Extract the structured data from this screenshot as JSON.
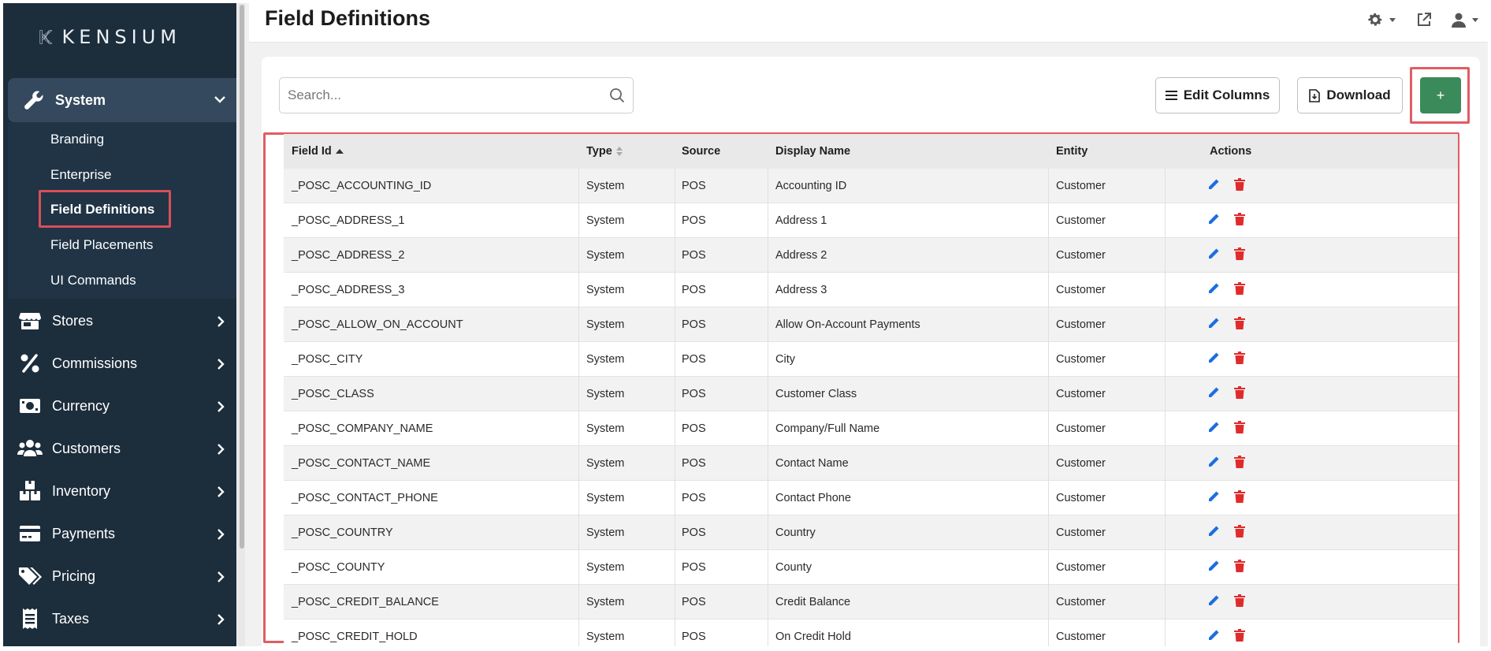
{
  "brand": {
    "name": "KENSIUM"
  },
  "sidebar": {
    "system": {
      "label": "System",
      "icon": "wrench-icon"
    },
    "sub_items": [
      {
        "label": "Branding"
      },
      {
        "label": "Enterprise"
      },
      {
        "label": "Field Definitions",
        "active": true
      },
      {
        "label": "Field Placements"
      },
      {
        "label": "UI Commands"
      }
    ],
    "items": [
      {
        "label": "Stores",
        "icon": "store-icon"
      },
      {
        "label": "Commissions",
        "icon": "percent-icon"
      },
      {
        "label": "Currency",
        "icon": "money-icon"
      },
      {
        "label": "Customers",
        "icon": "users-icon"
      },
      {
        "label": "Inventory",
        "icon": "boxes-icon"
      },
      {
        "label": "Payments",
        "icon": "credit-card-icon"
      },
      {
        "label": "Pricing",
        "icon": "tags-icon"
      },
      {
        "label": "Taxes",
        "icon": "receipt-icon"
      }
    ]
  },
  "header": {
    "title": "Field Definitions"
  },
  "toolbar": {
    "search_placeholder": "Search...",
    "edit_columns_label": "Edit Columns",
    "download_label": "Download",
    "add_label": "+"
  },
  "table": {
    "columns": [
      "Field Id",
      "Type",
      "Source",
      "Display Name",
      "Entity",
      "Actions"
    ],
    "rows": [
      {
        "field_id": "_POSC_ACCOUNTING_ID",
        "type": "System",
        "source": "POS",
        "display_name": "Accounting ID",
        "entity": "Customer"
      },
      {
        "field_id": "_POSC_ADDRESS_1",
        "type": "System",
        "source": "POS",
        "display_name": "Address 1",
        "entity": "Customer"
      },
      {
        "field_id": "_POSC_ADDRESS_2",
        "type": "System",
        "source": "POS",
        "display_name": "Address 2",
        "entity": "Customer"
      },
      {
        "field_id": "_POSC_ADDRESS_3",
        "type": "System",
        "source": "POS",
        "display_name": "Address 3",
        "entity": "Customer"
      },
      {
        "field_id": "_POSC_ALLOW_ON_ACCOUNT",
        "type": "System",
        "source": "POS",
        "display_name": "Allow On-Account Payments",
        "entity": "Customer"
      },
      {
        "field_id": "_POSC_CITY",
        "type": "System",
        "source": "POS",
        "display_name": "City",
        "entity": "Customer"
      },
      {
        "field_id": "_POSC_CLASS",
        "type": "System",
        "source": "POS",
        "display_name": "Customer Class",
        "entity": "Customer"
      },
      {
        "field_id": "_POSC_COMPANY_NAME",
        "type": "System",
        "source": "POS",
        "display_name": "Company/Full Name",
        "entity": "Customer"
      },
      {
        "field_id": "_POSC_CONTACT_NAME",
        "type": "System",
        "source": "POS",
        "display_name": "Contact Name",
        "entity": "Customer"
      },
      {
        "field_id": "_POSC_CONTACT_PHONE",
        "type": "System",
        "source": "POS",
        "display_name": "Contact Phone",
        "entity": "Customer"
      },
      {
        "field_id": "_POSC_COUNTRY",
        "type": "System",
        "source": "POS",
        "display_name": "Country",
        "entity": "Customer"
      },
      {
        "field_id": "_POSC_COUNTY",
        "type": "System",
        "source": "POS",
        "display_name": "County",
        "entity": "Customer"
      },
      {
        "field_id": "_POSC_CREDIT_BALANCE",
        "type": "System",
        "source": "POS",
        "display_name": "Credit Balance",
        "entity": "Customer"
      },
      {
        "field_id": "_POSC_CREDIT_HOLD",
        "type": "System",
        "source": "POS",
        "display_name": "On Credit Hold",
        "entity": "Customer"
      }
    ]
  },
  "colors": {
    "sidebar_bg": "#1c2d3c",
    "highlight": "#e05d62",
    "add_button": "#3b8a5a",
    "edit_icon": "#1a6fe0",
    "delete_icon": "#e02b2b"
  }
}
